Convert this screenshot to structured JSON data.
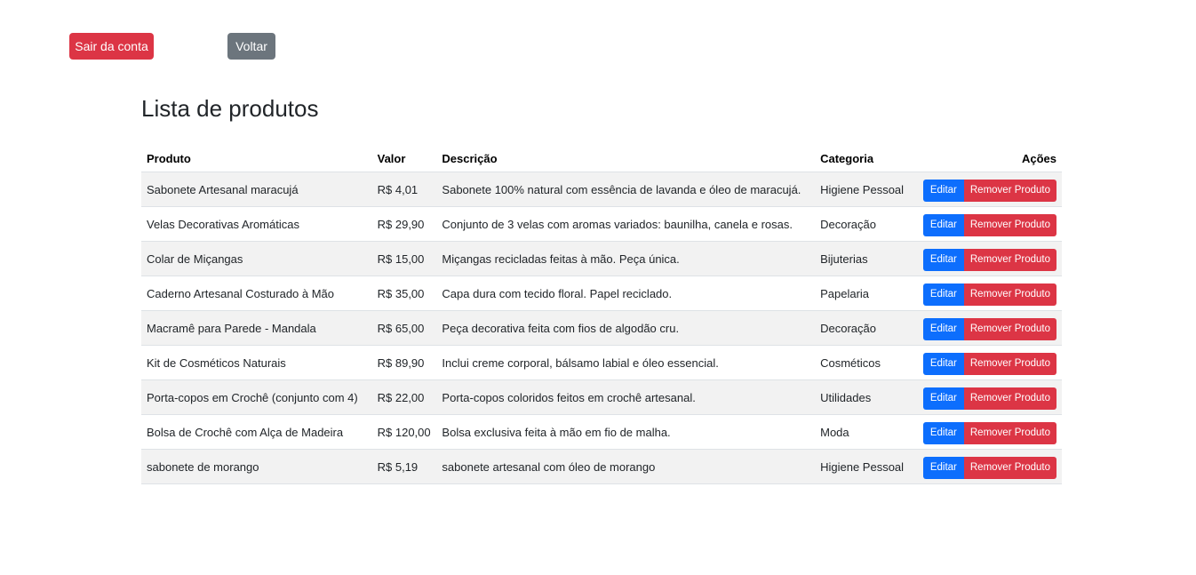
{
  "header": {
    "logout_label": "Sair da conta",
    "back_label": "Voltar"
  },
  "main": {
    "title": "Lista de produtos",
    "table": {
      "columns": [
        "Produto",
        "Valor",
        "Descrição",
        "Categoria",
        "Ações"
      ],
      "rows": [
        {
          "produto": "Sabonete Artesanal maracujá",
          "valor": "R$ 4,01",
          "descricao": "Sabonete 100% natural com essência de lavanda e óleo de maracujá.",
          "categoria": "Higiene Pessoal"
        },
        {
          "produto": "Velas Decorativas Aromáticas",
          "valor": "R$ 29,90",
          "descricao": "Conjunto de 3 velas com aromas variados: baunilha, canela e rosas.",
          "categoria": "Decoração"
        },
        {
          "produto": "Colar de Miçangas",
          "valor": "R$ 15,00",
          "descricao": "Miçangas recicladas feitas à mão. Peça única.",
          "categoria": "Bijuterias"
        },
        {
          "produto": "Caderno Artesanal Costurado à Mão",
          "valor": "R$ 35,00",
          "descricao": "Capa dura com tecido floral. Papel reciclado.",
          "categoria": "Papelaria"
        },
        {
          "produto": "Macramê para Parede - Mandala",
          "valor": "R$ 65,00",
          "descricao": "Peça decorativa feita com fios de algodão cru.",
          "categoria": "Decoração"
        },
        {
          "produto": "Kit de Cosméticos Naturais",
          "valor": "R$ 89,90",
          "descricao": "Inclui creme corporal, bálsamo labial e óleo essencial.",
          "categoria": "Cosméticos"
        },
        {
          "produto": "Porta-copos em Crochê (conjunto com 4)",
          "valor": "R$ 22,00",
          "descricao": "Porta-copos coloridos feitos em crochê artesanal.",
          "categoria": "Utilidades"
        },
        {
          "produto": "Bolsa de Crochê com Alça de Madeira",
          "valor": "R$ 120,00",
          "descricao": "Bolsa exclusiva feita à mão em fio de malha.",
          "categoria": "Moda"
        },
        {
          "produto": "sabonete de morango",
          "valor": "R$ 5,19",
          "descricao": "sabonete artesanal com óleo de morango",
          "categoria": "Higiene Pessoal"
        }
      ],
      "edit_label": "Editar",
      "remove_label": "Remover Produto"
    }
  },
  "colors": {
    "danger": "#dc3545",
    "secondary": "#6c757d",
    "primary": "#0d6efd",
    "stripe": "#f2f2f2"
  }
}
